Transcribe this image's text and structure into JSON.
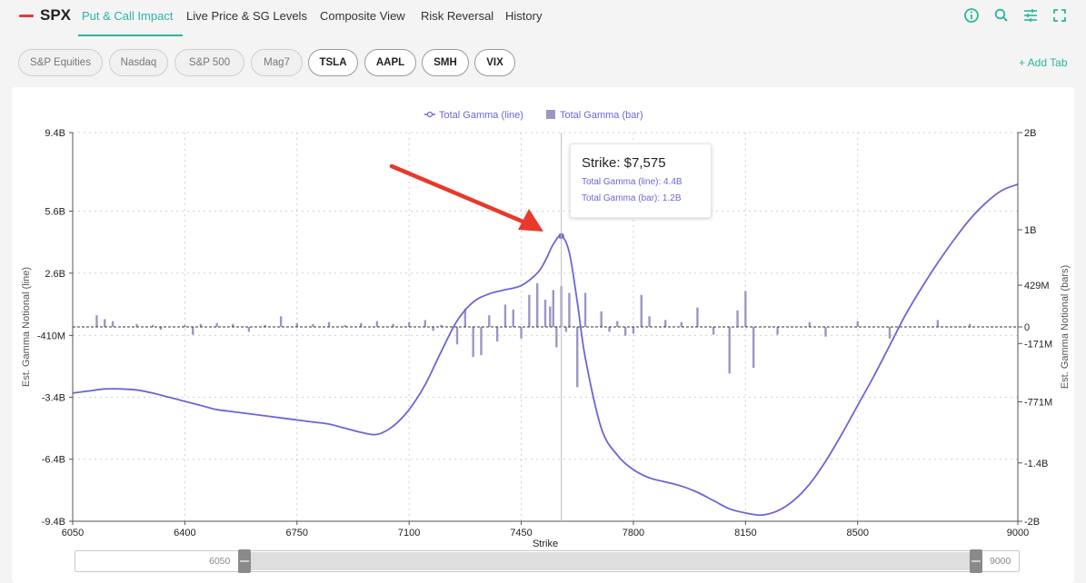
{
  "header": {
    "brand": "SPX",
    "tabs": [
      {
        "label": "Put & Call Impact",
        "active": true
      },
      {
        "label": "Live Price & SG Levels",
        "active": false
      },
      {
        "label": "Composite View",
        "active": false
      },
      {
        "label": "Risk Reversal",
        "active": false
      },
      {
        "label": "History",
        "active": false
      }
    ],
    "icons": [
      "info-icon",
      "search-icon",
      "sliders-icon",
      "fullscreen-icon"
    ]
  },
  "chips": [
    {
      "label": "S&P Equities",
      "style": "light"
    },
    {
      "label": "Nasdaq",
      "style": "light"
    },
    {
      "label": "S&P 500",
      "style": "light"
    },
    {
      "label": "Mag7",
      "style": "light"
    },
    {
      "label": "TSLA",
      "style": "dark"
    },
    {
      "label": "AAPL",
      "style": "dark"
    },
    {
      "label": "SMH",
      "style": "dark"
    },
    {
      "label": "VIX",
      "style": "dark"
    }
  ],
  "add_tab_label": "+ Add Tab",
  "colors": {
    "accent": "#2bb5a0",
    "line": "#6b66d6",
    "bar": "#9b97c4",
    "arrow": "#e8392c"
  },
  "tooltip": {
    "title": "Strike: $7,575",
    "line_row": "Total Gamma (line): 4.4B",
    "bar_row": "Total Gamma (bar): 1.2B"
  },
  "slider": {
    "min_label": "6050",
    "max_label": "9000"
  },
  "chart_data": {
    "type": "line",
    "xlabel": "Strike",
    "ylabel": "Est. Gamma Notional (line)",
    "y2label": "Est. Gamma Notional (bars)",
    "xlim": [
      6050,
      9000
    ],
    "ylim": [
      -9.4,
      9.4
    ],
    "y2lim": [
      -2,
      2
    ],
    "x_ticks": [
      6050,
      6400,
      6750,
      7100,
      7450,
      7800,
      8150,
      8500,
      9000
    ],
    "y_tick_labels": [
      "9.4B",
      "5.6B",
      "2.6B",
      "-410M",
      "-3.4B",
      "-6.4B",
      "-9.4B"
    ],
    "y_tick_values": [
      9.4,
      5.6,
      2.6,
      -0.41,
      -3.4,
      -6.4,
      -9.4
    ],
    "y2_tick_labels": [
      "2B",
      "1B",
      "429M",
      "0",
      "-171M",
      "-771M",
      "-1.4B",
      "-2B"
    ],
    "y2_tick_values": [
      2,
      1,
      0.429,
      0,
      -0.171,
      -0.771,
      -1.4,
      -2
    ],
    "legend": [
      "Total Gamma (line)",
      "Total Gamma (bar)"
    ],
    "legend_position": "top-center",
    "grid": true,
    "highlight_strike": 7575,
    "series": [
      {
        "name": "Total Gamma (line)",
        "kind": "line",
        "x": [
          6050,
          6100,
          6150,
          6200,
          6250,
          6300,
          6350,
          6400,
          6450,
          6500,
          6550,
          6600,
          6650,
          6700,
          6750,
          6800,
          6850,
          6900,
          6950,
          7000,
          7050,
          7100,
          7150,
          7200,
          7250,
          7300,
          7350,
          7400,
          7450,
          7500,
          7525,
          7550,
          7575,
          7600,
          7625,
          7650,
          7700,
          7750,
          7800,
          7850,
          7900,
          7950,
          8000,
          8050,
          8100,
          8150,
          8200,
          8250,
          8300,
          8350,
          8400,
          8450,
          8500,
          8550,
          8600,
          8650,
          8700,
          8750,
          8800,
          8850,
          8900,
          8950,
          9000
        ],
        "y": [
          -3.2,
          -3.1,
          -3.0,
          -3.0,
          -3.05,
          -3.2,
          -3.4,
          -3.6,
          -3.8,
          -4.0,
          -4.1,
          -4.2,
          -4.3,
          -4.4,
          -4.5,
          -4.6,
          -4.7,
          -4.9,
          -5.1,
          -5.2,
          -4.8,
          -4.0,
          -2.8,
          -1.2,
          0.3,
          1.2,
          1.6,
          1.8,
          2.0,
          2.6,
          3.2,
          4.0,
          4.4,
          3.6,
          1.2,
          -1.5,
          -4.9,
          -6.2,
          -6.9,
          -7.3,
          -7.5,
          -7.7,
          -8.0,
          -8.4,
          -8.8,
          -9.0,
          -9.1,
          -8.9,
          -8.4,
          -7.6,
          -6.5,
          -5.2,
          -3.8,
          -2.4,
          -0.9,
          0.6,
          1.9,
          3.1,
          4.2,
          5.2,
          6.0,
          6.6,
          6.9
        ]
      },
      {
        "name": "Total Gamma (bar)",
        "kind": "bar",
        "x": [
          6125,
          6150,
          6175,
          6250,
          6300,
          6325,
          6400,
          6425,
          6450,
          6500,
          6550,
          6600,
          6650,
          6700,
          6750,
          6800,
          6850,
          6900,
          6950,
          7000,
          7050,
          7100,
          7150,
          7175,
          7200,
          7250,
          7275,
          7300,
          7325,
          7350,
          7375,
          7400,
          7425,
          7450,
          7475,
          7500,
          7525,
          7540,
          7550,
          7560,
          7575,
          7590,
          7600,
          7625,
          7650,
          7700,
          7725,
          7750,
          7775,
          7800,
          7825,
          7850,
          7900,
          7950,
          8000,
          8050,
          8100,
          8125,
          8150,
          8175,
          8250,
          8350,
          8400,
          8500,
          8600,
          8750,
          8850
        ],
        "y": [
          0.12,
          0.08,
          0.06,
          0.03,
          0.02,
          -0.03,
          0.02,
          -0.08,
          0.03,
          0.04,
          0.03,
          -0.05,
          0.02,
          0.11,
          0.04,
          0.03,
          0.05,
          0.02,
          0.04,
          0.06,
          0.03,
          0.05,
          0.07,
          -0.04,
          0.02,
          -0.18,
          0.19,
          -0.31,
          -0.29,
          0.12,
          -0.15,
          0.23,
          0.18,
          -0.12,
          0.33,
          0.45,
          0.28,
          0.21,
          0.38,
          -0.21,
          0.42,
          -0.05,
          0.35,
          -0.62,
          0.35,
          0.16,
          -0.05,
          0.06,
          -0.09,
          -0.07,
          0.33,
          0.11,
          0.07,
          0.05,
          0.2,
          -0.08,
          -0.48,
          0.17,
          0.37,
          -0.42,
          -0.08,
          0.05,
          -0.1,
          0.06,
          -0.12,
          0.07,
          0.03
        ]
      }
    ]
  }
}
